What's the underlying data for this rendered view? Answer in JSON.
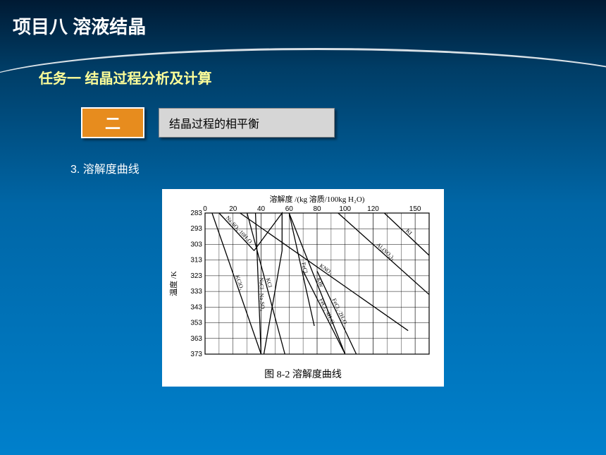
{
  "title": "项目八 溶液结晶",
  "subtitle": "任务一 结晶过程分析及计算",
  "badge": "二",
  "section_label": "结晶过程的相平衡",
  "body_point": "3. 溶解度曲线",
  "chart_caption": "图 8-2  溶解度曲线",
  "chart_data": {
    "type": "line",
    "xlabel": "溶解度 /(kg 溶质/100kg H₂O)",
    "ylabel": "温度 /K",
    "x_ticks": [
      0,
      20,
      40,
      60,
      80,
      100,
      120,
      150
    ],
    "y_ticks": [
      283,
      293,
      303,
      313,
      323,
      333,
      343,
      353,
      363,
      373
    ],
    "xlim": [
      0,
      160
    ],
    "ylim": [
      283,
      373
    ],
    "y_direction": "increasing_down",
    "series": [
      {
        "name": "Na₂SO₄·10H₂O",
        "points": [
          [
            10,
            283
          ],
          [
            35,
            307
          ]
        ]
      },
      {
        "name": "Na₂SO₄",
        "points": [
          [
            35,
            307
          ],
          [
            55,
            283
          ],
          [
            55,
            307
          ],
          [
            42,
            373
          ]
        ]
      },
      {
        "name": "KClO₃",
        "points": [
          [
            5,
            283
          ],
          [
            40,
            373
          ]
        ]
      },
      {
        "name": "NaCl",
        "points": [
          [
            36,
            283
          ],
          [
            40,
            373
          ]
        ]
      },
      {
        "name": "KCl",
        "points": [
          [
            30,
            283
          ],
          [
            57,
            373
          ]
        ]
      },
      {
        "name": "FeCl₂",
        "points": [
          [
            60,
            283
          ],
          [
            78,
            355
          ]
        ]
      },
      {
        "name": "KBr",
        "points": [
          [
            60,
            283
          ],
          [
            100,
            373
          ]
        ]
      },
      {
        "name": "FeCl₂·4H₂O",
        "points": [
          [
            70,
            320
          ],
          [
            100,
            373
          ]
        ]
      },
      {
        "name": "FeCl₂·2H₂O",
        "points": [
          [
            80,
            320
          ],
          [
            108,
            373
          ]
        ]
      },
      {
        "name": "KNO₃",
        "points": [
          [
            25,
            283
          ],
          [
            145,
            358
          ]
        ]
      },
      {
        "name": "Al₂(SO₄)₃",
        "points": [
          [
            95,
            283
          ],
          [
            160,
            335
          ]
        ]
      },
      {
        "name": "KI",
        "points": [
          [
            128,
            283
          ],
          [
            160,
            310
          ]
        ]
      }
    ]
  }
}
